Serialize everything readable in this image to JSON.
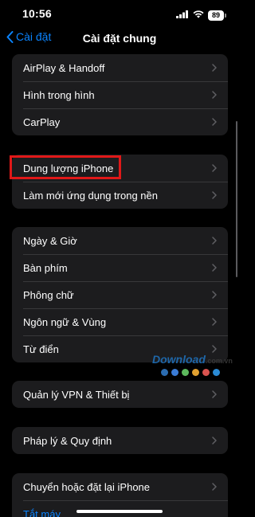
{
  "status_bar": {
    "time": "10:56",
    "battery": "89"
  },
  "nav": {
    "back_label": "Cài đặt",
    "title": "Cài đặt chung"
  },
  "groups": [
    {
      "items": [
        {
          "label": "AirPlay & Handoff"
        },
        {
          "label": "Hình trong hình"
        },
        {
          "label": "CarPlay"
        }
      ]
    },
    {
      "items": [
        {
          "label": "Dung lượng iPhone"
        },
        {
          "label": "Làm mới ứng dụng trong nền"
        }
      ]
    },
    {
      "items": [
        {
          "label": "Ngày & Giờ"
        },
        {
          "label": "Bàn phím"
        },
        {
          "label": "Phông chữ"
        },
        {
          "label": "Ngôn ngữ & Vùng"
        },
        {
          "label": "Từ điển"
        }
      ]
    },
    {
      "items": [
        {
          "label": "Quản lý VPN & Thiết bị"
        }
      ]
    },
    {
      "items": [
        {
          "label": "Pháp lý & Quy định"
        }
      ]
    },
    {
      "items": [
        {
          "label": "Chuyển hoặc đặt lại iPhone"
        },
        {
          "label": "Tắt máy"
        }
      ]
    }
  ],
  "watermark": {
    "text": "Download",
    "suffix": ".com.vn",
    "dot_colors": [
      "#2b6cb0",
      "#3a7bd5",
      "#5cb85c",
      "#e0a030",
      "#d9534f",
      "#2a8ad4"
    ]
  },
  "colors": {
    "accent": "#0a84ff",
    "background": "#000000",
    "group_background": "#1c1c1e",
    "highlight": "#e01818"
  }
}
